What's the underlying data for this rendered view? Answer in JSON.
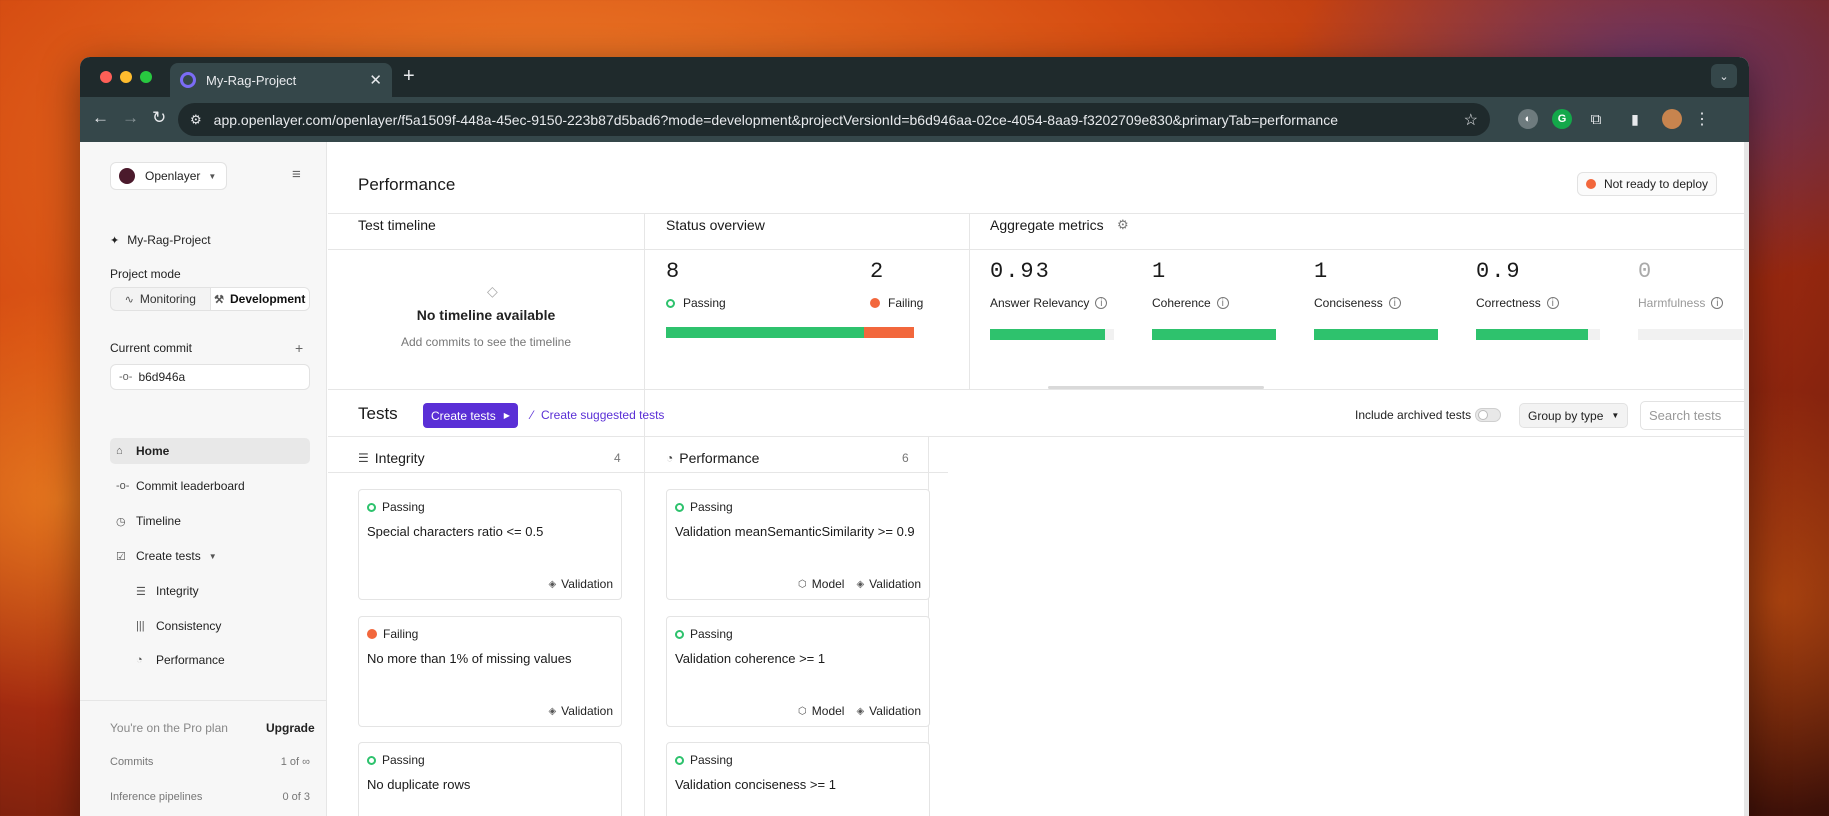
{
  "browser": {
    "tab_title": "My-Rag-Project",
    "new_tab_symbol": "+",
    "url": "app.openlayer.com/openlayer/f5a1509f-448a-45ec-9150-223b87d5bad6?mode=development&projectVersionId=b6d946aa-02ce-4054-8aa9-f3202709e830&primaryTab=performance",
    "icons": [
      "back-arrow-icon",
      "forward-arrow-icon",
      "reload-icon",
      "site-info-icon",
      "star-icon",
      "extensions-icon"
    ]
  },
  "sidebar": {
    "org_name": "Openlayer",
    "project_name": "My-Rag-Project",
    "project_mode_label": "Project mode",
    "modes": [
      {
        "label": "Monitoring",
        "active": false
      },
      {
        "label": "Development",
        "active": true
      }
    ],
    "current_commit_label": "Current commit",
    "current_commit": "b6d946a",
    "nav": [
      {
        "label": "Home",
        "icon": "home-icon",
        "active": true
      },
      {
        "label": "Commit leaderboard",
        "icon": "commit-icon"
      },
      {
        "label": "Timeline",
        "icon": "clock-icon"
      },
      {
        "label": "Create tests",
        "icon": "checkbox-icon"
      }
    ],
    "sub_nav": [
      {
        "label": "Integrity",
        "icon": "list-icon"
      },
      {
        "label": "Consistency",
        "icon": "bars-icon"
      },
      {
        "label": "Performance",
        "icon": "pie-icon"
      }
    ],
    "plan_text": "You're on the Pro plan",
    "upgrade_label": "Upgrade",
    "commits_label": "Commits",
    "commits_value": "1 of ∞",
    "pipelines_label": "Inference pipelines",
    "pipelines_value": "0 of 3"
  },
  "main": {
    "title": "Performance",
    "deploy_status": "Not ready to deploy",
    "timeline": {
      "title": "Test timeline",
      "empty_title": "No timeline available",
      "empty_sub": "Add commits to see the timeline"
    },
    "status": {
      "title": "Status overview",
      "passing_count": "8",
      "passing_label": "Passing",
      "failing_count": "2",
      "failing_label": "Failing",
      "pass_fraction": 0.8
    },
    "aggregate": {
      "title": "Aggregate metrics",
      "metrics": [
        {
          "value": "0.93",
          "label": "Answer Relevancy",
          "fill": 0.93,
          "muted": false
        },
        {
          "value": "1",
          "label": "Coherence",
          "fill": 1,
          "muted": false
        },
        {
          "value": "1",
          "label": "Conciseness",
          "fill": 1,
          "muted": false
        },
        {
          "value": "0.9",
          "label": "Correctness",
          "fill": 0.9,
          "muted": false
        },
        {
          "value": "0",
          "label": "Harmfulness",
          "fill": 0,
          "muted": true
        }
      ]
    },
    "tests": {
      "title": "Tests",
      "create_label": "Create tests",
      "suggest_label": "Create suggested tests",
      "archived_label": "Include archived tests",
      "groupby_label": "Group by type",
      "search_placeholder": "Search tests",
      "columns": [
        {
          "title": "Integrity",
          "count": "4",
          "cards": [
            {
              "status": "Passing",
              "name": "Special characters ratio <= 0.5",
              "tags": [
                "Validation"
              ]
            },
            {
              "status": "Failing",
              "name": "No more than 1% of missing values",
              "tags": [
                "Validation"
              ]
            },
            {
              "status": "Passing",
              "name": "No duplicate rows",
              "tags": []
            }
          ]
        },
        {
          "title": "Performance",
          "count": "6",
          "cards": [
            {
              "status": "Passing",
              "name": "Validation meanSemanticSimilarity >= 0.9",
              "tags": [
                "Model",
                "Validation"
              ]
            },
            {
              "status": "Passing",
              "name": "Validation coherence >= 1",
              "tags": [
                "Model",
                "Validation"
              ]
            },
            {
              "status": "Passing",
              "name": "Validation conciseness >= 1",
              "tags": []
            }
          ]
        }
      ]
    }
  },
  "colors": {
    "accent": "#5a2fd6",
    "pass": "#2ec26d",
    "fail": "#f2673c"
  }
}
